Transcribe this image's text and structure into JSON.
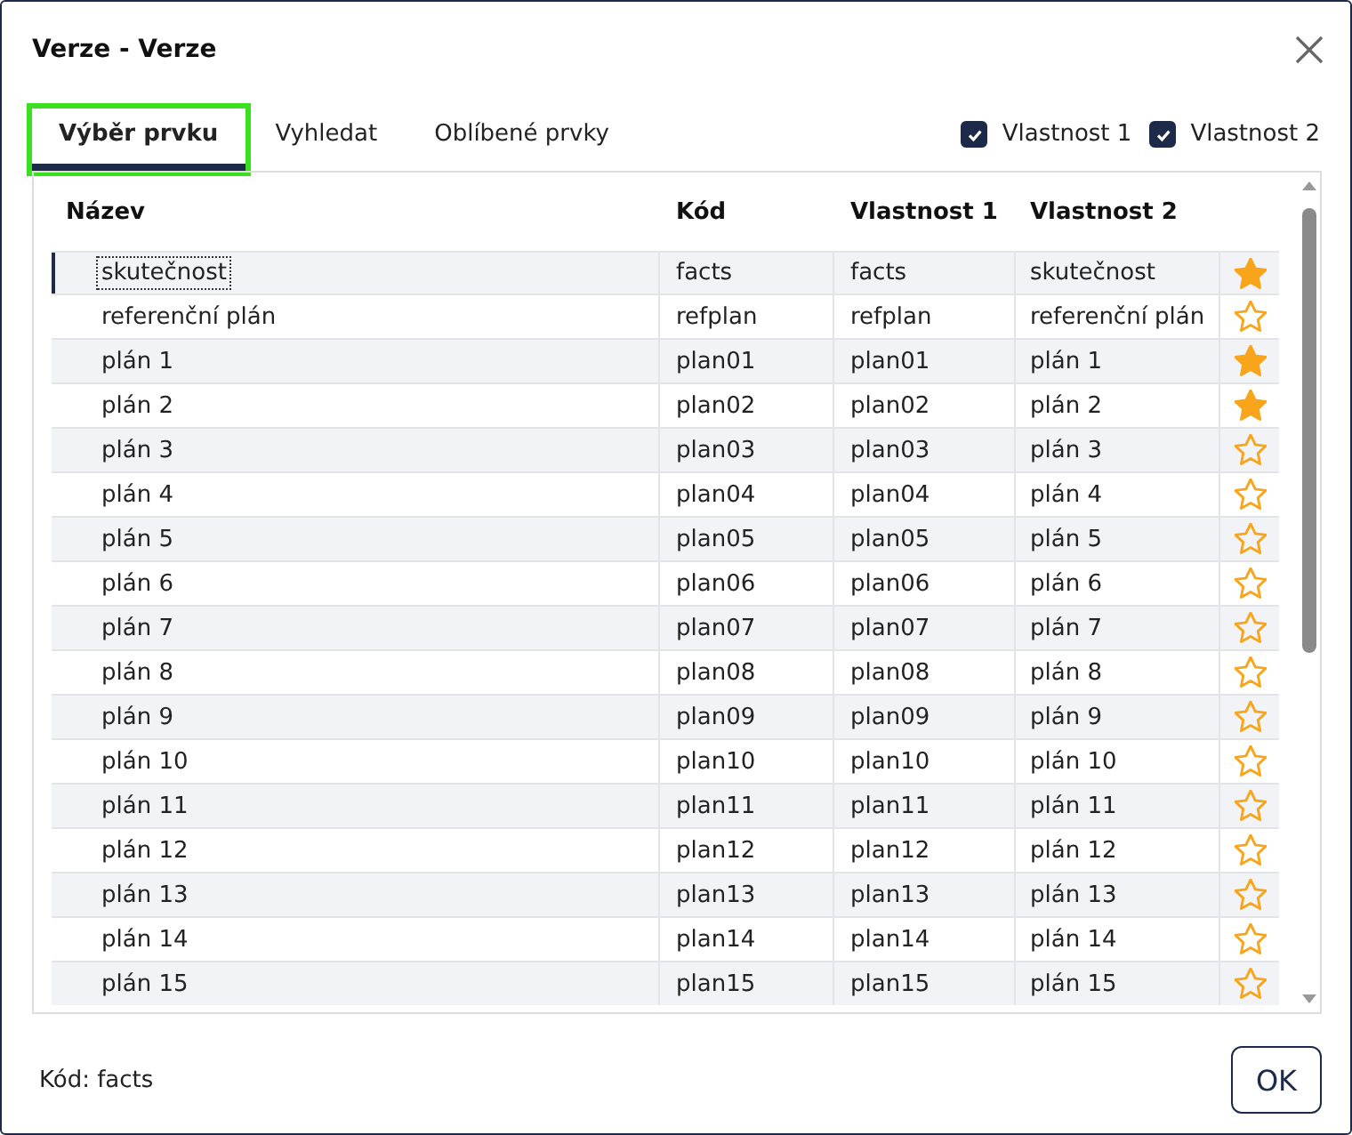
{
  "window": {
    "title": "Verze - Verze"
  },
  "tabs": [
    {
      "label": "Výběr prvku",
      "selected": true
    },
    {
      "label": "Vyhledat",
      "selected": false
    },
    {
      "label": "Oblíbené prvky",
      "selected": false
    }
  ],
  "options": [
    {
      "label": "Vlastnost 1",
      "checked": true
    },
    {
      "label": "Vlastnost 2",
      "checked": true
    }
  ],
  "table": {
    "columns": [
      "Název",
      "Kód",
      "Vlastnost 1",
      "Vlastnost 2"
    ],
    "rows": [
      {
        "name": "skutečnost",
        "code": "facts",
        "prop1": "facts",
        "prop2": "skutečnost",
        "favorite": true,
        "selected": true
      },
      {
        "name": "referenční plán",
        "code": "refplan",
        "prop1": "refplan",
        "prop2": "referenční plán",
        "favorite": false,
        "selected": false
      },
      {
        "name": "plán 1",
        "code": "plan01",
        "prop1": "plan01",
        "prop2": "plán 1",
        "favorite": true,
        "selected": false
      },
      {
        "name": "plán 2",
        "code": "plan02",
        "prop1": "plan02",
        "prop2": "plán 2",
        "favorite": true,
        "selected": false
      },
      {
        "name": "plán 3",
        "code": "plan03",
        "prop1": "plan03",
        "prop2": "plán 3",
        "favorite": false,
        "selected": false
      },
      {
        "name": "plán 4",
        "code": "plan04",
        "prop1": "plan04",
        "prop2": "plán 4",
        "favorite": false,
        "selected": false
      },
      {
        "name": "plán 5",
        "code": "plan05",
        "prop1": "plan05",
        "prop2": "plán 5",
        "favorite": false,
        "selected": false
      },
      {
        "name": "plán 6",
        "code": "plan06",
        "prop1": "plan06",
        "prop2": "plán 6",
        "favorite": false,
        "selected": false
      },
      {
        "name": "plán 7",
        "code": "plan07",
        "prop1": "plan07",
        "prop2": "plán 7",
        "favorite": false,
        "selected": false
      },
      {
        "name": "plán 8",
        "code": "plan08",
        "prop1": "plan08",
        "prop2": "plán 8",
        "favorite": false,
        "selected": false
      },
      {
        "name": "plán 9",
        "code": "plan09",
        "prop1": "plan09",
        "prop2": "plán 9",
        "favorite": false,
        "selected": false
      },
      {
        "name": "plán 10",
        "code": "plan10",
        "prop1": "plan10",
        "prop2": "plán 10",
        "favorite": false,
        "selected": false
      },
      {
        "name": "plán 11",
        "code": "plan11",
        "prop1": "plan11",
        "prop2": "plán 11",
        "favorite": false,
        "selected": false
      },
      {
        "name": "plán 12",
        "code": "plan12",
        "prop1": "plan12",
        "prop2": "plán 12",
        "favorite": false,
        "selected": false
      },
      {
        "name": "plán 13",
        "code": "plan13",
        "prop1": "plan13",
        "prop2": "plán 13",
        "favorite": false,
        "selected": false
      },
      {
        "name": "plán 14",
        "code": "plan14",
        "prop1": "plan14",
        "prop2": "plán 14",
        "favorite": false,
        "selected": false
      },
      {
        "name": "plán 15",
        "code": "plan15",
        "prop1": "plan15",
        "prop2": "plán 15",
        "favorite": false,
        "selected": false
      }
    ]
  },
  "status": "Kód: facts",
  "buttons": [
    "OK"
  ]
}
